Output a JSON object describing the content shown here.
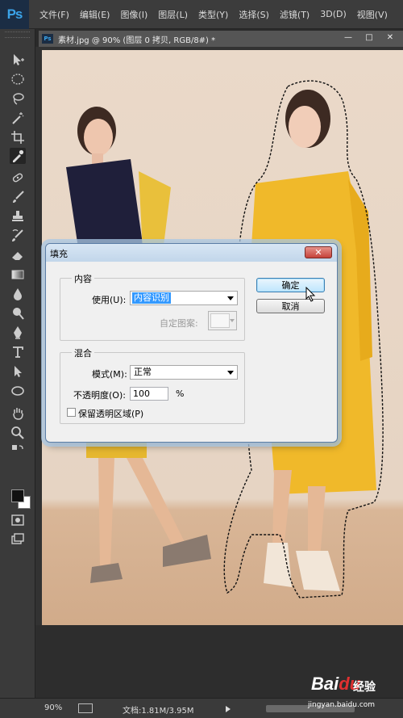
{
  "app": {
    "logo": "Ps"
  },
  "menubar": {
    "items": [
      "文件(F)",
      "编辑(E)",
      "图像(I)",
      "图层(L)",
      "类型(Y)",
      "选择(S)",
      "滤镜(T)",
      "3D(D)",
      "视图(V)"
    ]
  },
  "document": {
    "tab_icon": "Ps",
    "title": "素材.jpg @ 90% (图层 0 拷贝, RGB/8#) *",
    "window_buttons": {
      "minimize": "—",
      "maximize": "□",
      "close": "✕"
    }
  },
  "tools": [
    "move-icon",
    "marquee-icon",
    "lasso-icon",
    "magic-wand-icon",
    "crop-icon",
    "eyedropper-icon",
    "spot-heal-icon",
    "brush-icon",
    "stamp-icon",
    "history-brush-icon",
    "eraser-icon",
    "gradient-icon",
    "blur-icon",
    "dodge-icon",
    "pen-icon",
    "type-icon",
    "path-select-icon",
    "ellipse-shape-icon",
    "hand-icon",
    "zoom-icon",
    "quick-mask-icon",
    "screen-mode-icon"
  ],
  "dialog": {
    "title": "填充",
    "close_label": "✕",
    "content_group": {
      "label": "内容",
      "use_label": "使用(U):",
      "use_value": "内容识别",
      "custom_pattern_label": "自定图案:"
    },
    "blend_group": {
      "label": "混合",
      "mode_label": "模式(M):",
      "mode_value": "正常",
      "opacity_label": "不透明度(O):",
      "opacity_value": "100",
      "opacity_unit": "%",
      "preserve_label": "保留透明区域(P)",
      "preserve_checked": false
    },
    "ok_label": "确定",
    "cancel_label": "取消"
  },
  "statusbar": {
    "zoom": "90%",
    "doc_info": "文档:1.81M/3.95M"
  },
  "watermark": {
    "brand": "Bai",
    "paw": "du",
    "sub": "经验",
    "url": "jingyan.baidu.com"
  }
}
